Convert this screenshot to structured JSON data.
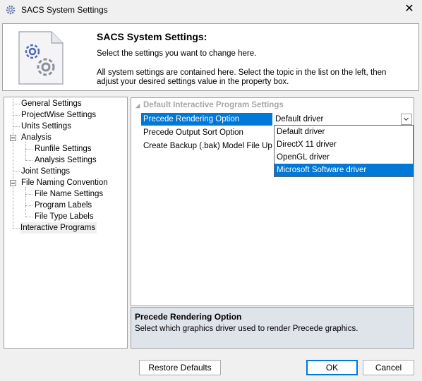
{
  "window": {
    "title": "SACS System Settings",
    "close_glyph": "✕"
  },
  "header": {
    "title": "SACS System Settings:",
    "line1": "Select the settings you want to change here.",
    "line2": "All system settings are contained here. Select the topic in the list on the left, then adjust your desired settings value in the property box.",
    "icon": "settings-gears-icon"
  },
  "tree": {
    "items": [
      {
        "label": "General Settings"
      },
      {
        "label": "ProjectWise Settings"
      },
      {
        "label": "Units Settings"
      },
      {
        "label": "Analysis"
      },
      {
        "label": "Runfile Settings"
      },
      {
        "label": "Analysis Settings"
      },
      {
        "label": "Joint Settings"
      },
      {
        "label": "File Naming Convention"
      },
      {
        "label": "File Name Settings"
      },
      {
        "label": "Program Labels"
      },
      {
        "label": "File Type Labels"
      },
      {
        "label": "Interactive Programs"
      }
    ],
    "selected": "Interactive Programs"
  },
  "grid": {
    "category": "Default Interactive Program Settings",
    "properties": [
      {
        "name": "Precede Rendering Option",
        "value": "Default driver"
      },
      {
        "name": "Precede Output Sort Option",
        "value": ""
      },
      {
        "name": "Create Backup (.bak) Model File Upon Save",
        "value": ""
      }
    ],
    "dropdown_options": [
      "Default driver",
      "DirectX 11 driver",
      "OpenGL driver",
      "Microsoft Software driver"
    ],
    "highlighted_option": "Microsoft Software driver"
  },
  "description": {
    "title": "Precede Rendering Option",
    "text": "Select which graphics driver used to render Precede graphics."
  },
  "buttons": {
    "restore": "Restore Defaults",
    "ok": "OK",
    "cancel": "Cancel"
  },
  "colors": {
    "selection": "#0078d7",
    "description_bg": "#dfe3ea"
  }
}
